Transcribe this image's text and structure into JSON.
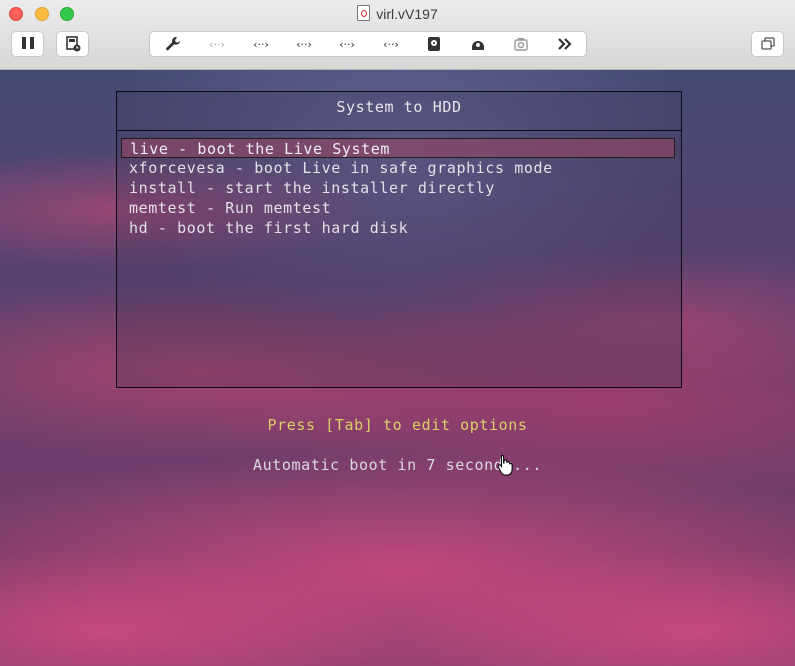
{
  "window": {
    "title": "virl.vV197",
    "colors": {
      "close": "#fc605c",
      "minimize": "#fdbc40",
      "maximize": "#34c84a"
    }
  },
  "toolbar": {
    "pause_icon": "pause-icon",
    "snapshot_icon": "snapshot-icon",
    "group_icons": [
      "wrench-icon",
      "network-adapter-icon",
      "network-adapter-icon",
      "network-adapter-icon",
      "network-adapter-icon",
      "network-adapter-icon",
      "hard-disk-icon",
      "disk-eject-icon",
      "camera-icon",
      "chevron-double-right-icon"
    ],
    "fullscreen_icon": "window-restore-icon"
  },
  "boot_menu": {
    "title": "System to HDD",
    "entries": [
      {
        "label": "live - boot the Live System",
        "selected": true
      },
      {
        "label": "xforcevesa - boot Live in safe graphics mode",
        "selected": false
      },
      {
        "label": "install - start the installer directly",
        "selected": false
      },
      {
        "label": "memtest - Run memtest",
        "selected": false
      },
      {
        "label": "hd - boot the first hard disk",
        "selected": false
      }
    ],
    "tab_hint": "Press [Tab] to edit options",
    "autoboot": "Automatic boot in 7 seconds...",
    "colors": {
      "hint": "#d9d067",
      "text": "#e4e0e8",
      "selection": "#8c4664"
    }
  }
}
